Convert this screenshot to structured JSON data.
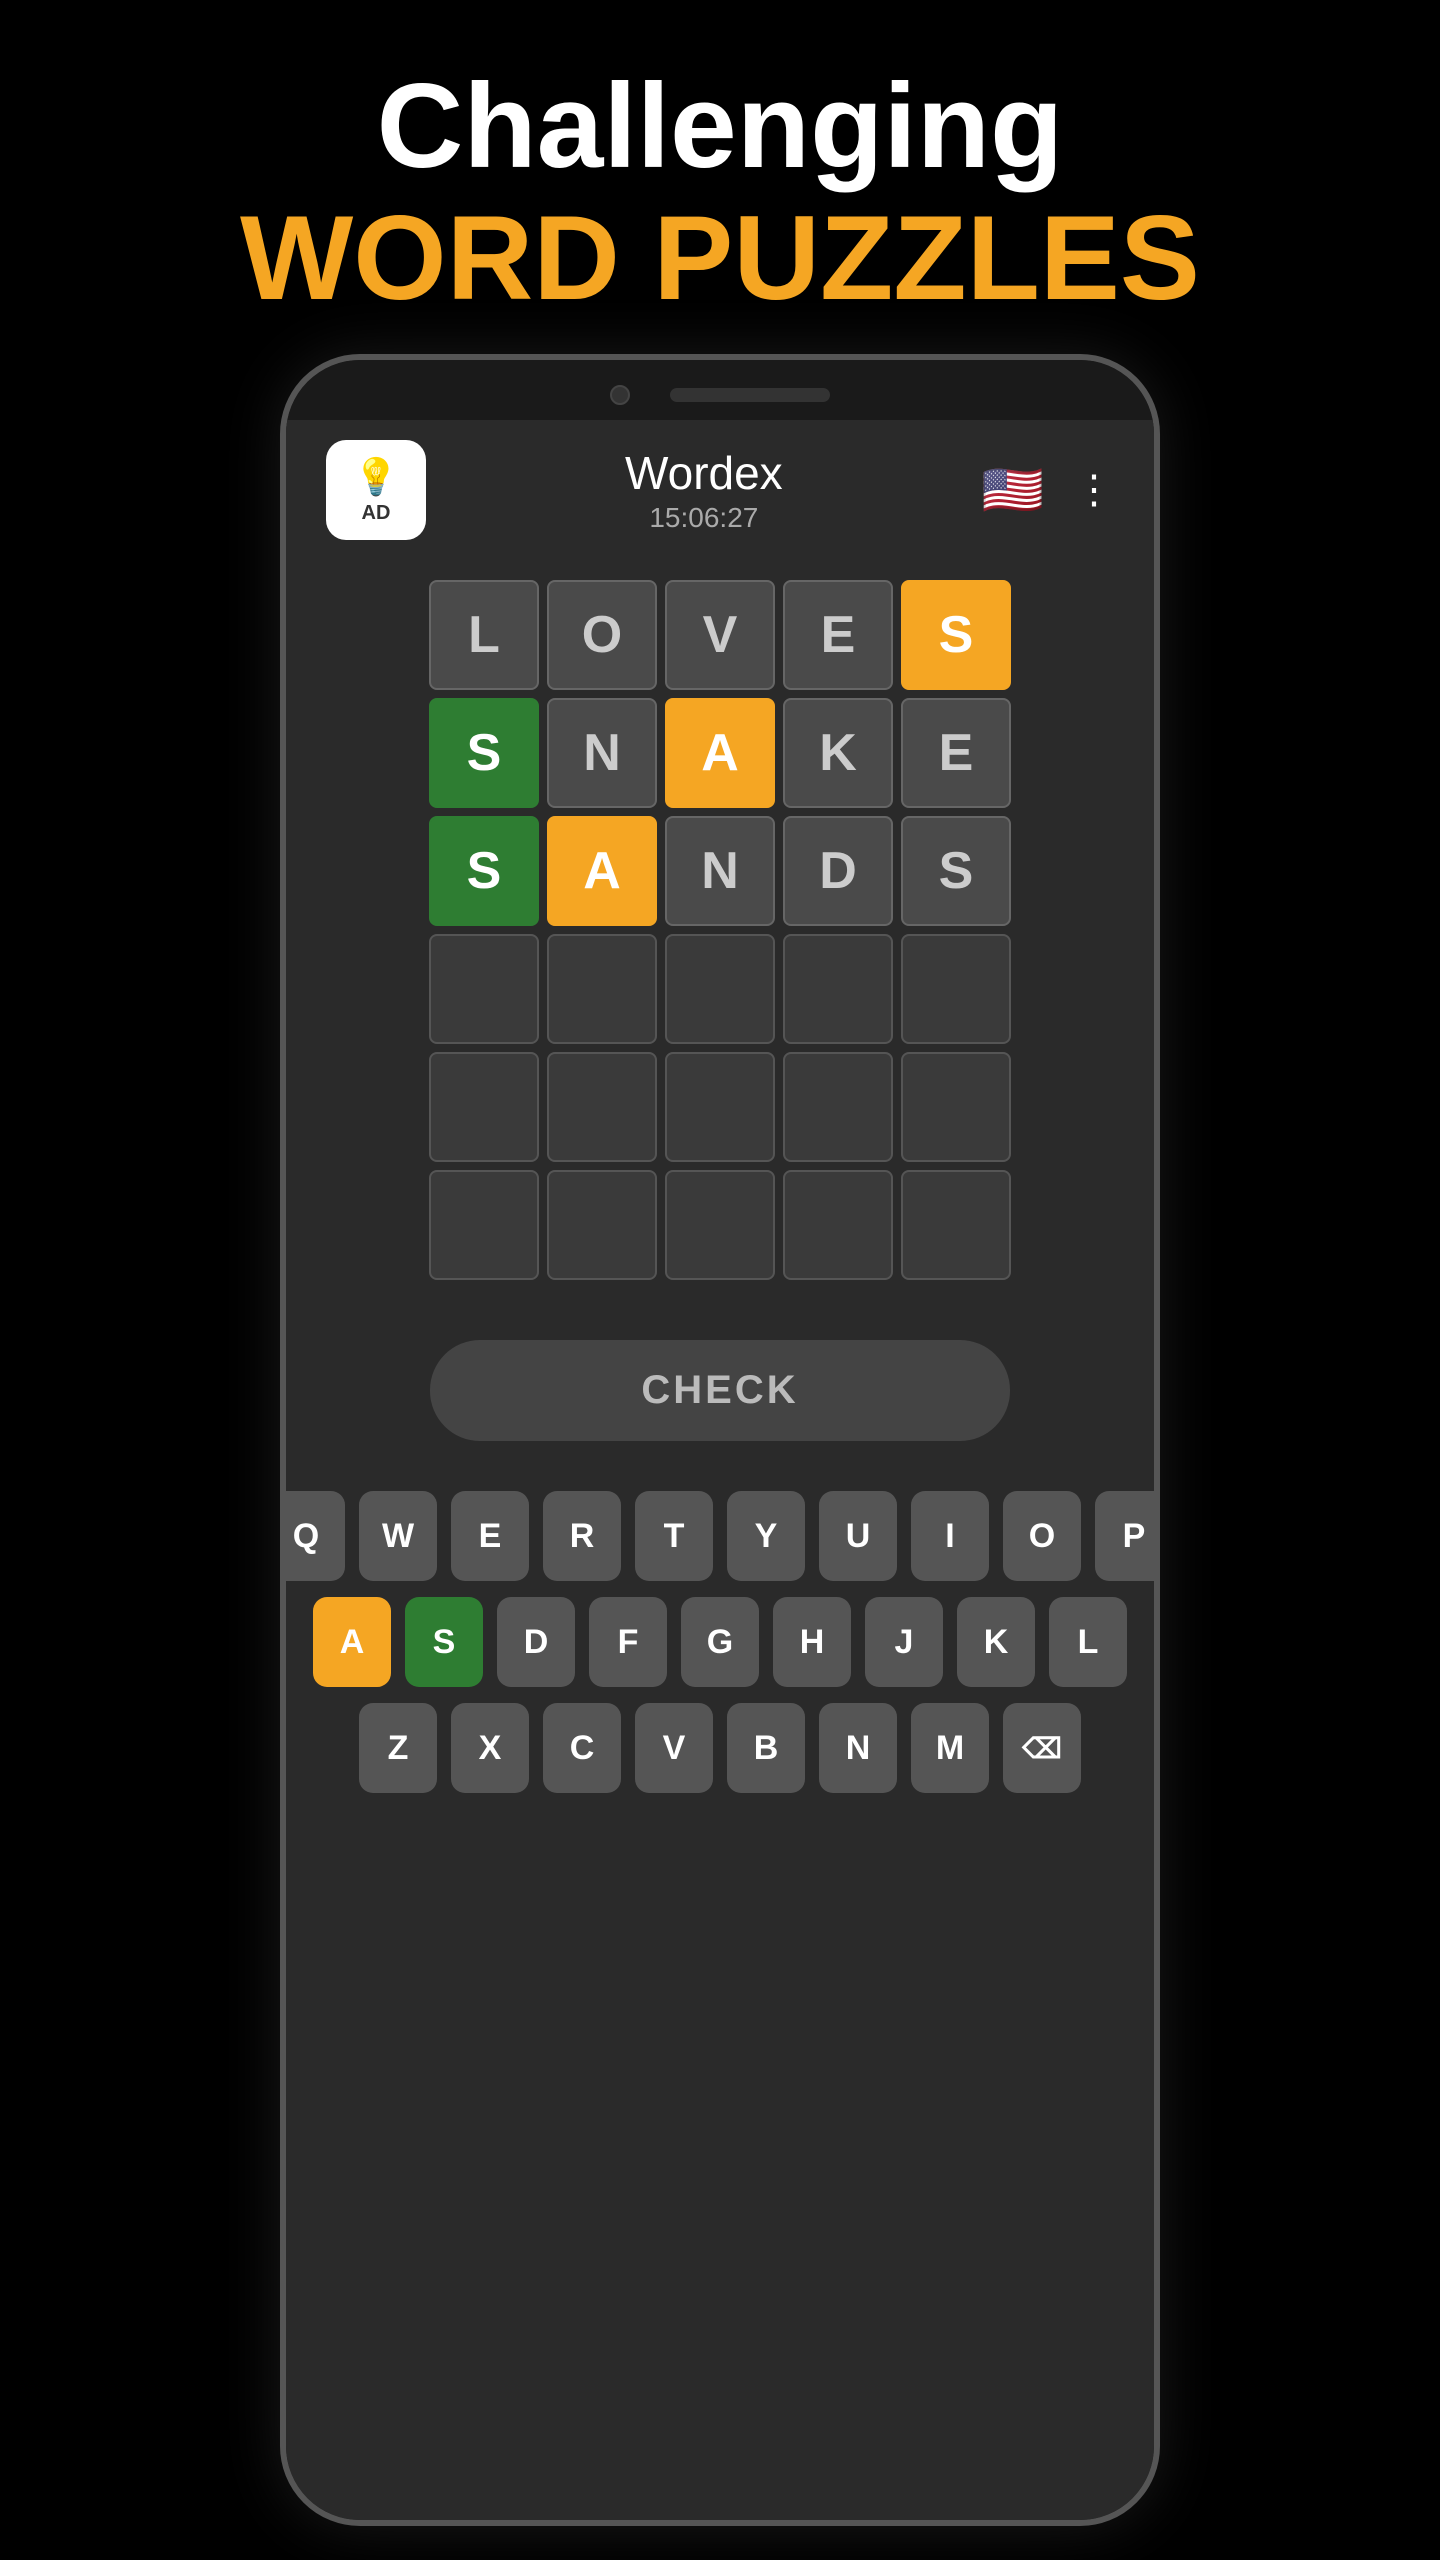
{
  "header": {
    "line1": "Challenging",
    "line2": "WORD PUZZLES"
  },
  "app": {
    "title": "Wordex",
    "timer": "15:06:27",
    "ad_label": "AD"
  },
  "grid": {
    "rows": [
      [
        {
          "letter": "L",
          "state": "letter"
        },
        {
          "letter": "O",
          "state": "letter"
        },
        {
          "letter": "V",
          "state": "letter"
        },
        {
          "letter": "E",
          "state": "letter"
        },
        {
          "letter": "S",
          "state": "yellow"
        }
      ],
      [
        {
          "letter": "S",
          "state": "green"
        },
        {
          "letter": "N",
          "state": "letter"
        },
        {
          "letter": "A",
          "state": "yellow"
        },
        {
          "letter": "K",
          "state": "letter"
        },
        {
          "letter": "E",
          "state": "letter"
        }
      ],
      [
        {
          "letter": "S",
          "state": "green"
        },
        {
          "letter": "A",
          "state": "yellow"
        },
        {
          "letter": "N",
          "state": "letter"
        },
        {
          "letter": "D",
          "state": "letter"
        },
        {
          "letter": "S",
          "state": "letter"
        }
      ],
      [
        {
          "letter": "",
          "state": "empty"
        },
        {
          "letter": "",
          "state": "empty"
        },
        {
          "letter": "",
          "state": "empty"
        },
        {
          "letter": "",
          "state": "empty"
        },
        {
          "letter": "",
          "state": "empty"
        }
      ],
      [
        {
          "letter": "",
          "state": "empty"
        },
        {
          "letter": "",
          "state": "empty"
        },
        {
          "letter": "",
          "state": "empty"
        },
        {
          "letter": "",
          "state": "empty"
        },
        {
          "letter": "",
          "state": "empty"
        }
      ],
      [
        {
          "letter": "",
          "state": "empty"
        },
        {
          "letter": "",
          "state": "empty"
        },
        {
          "letter": "",
          "state": "empty"
        },
        {
          "letter": "",
          "state": "empty"
        },
        {
          "letter": "",
          "state": "empty"
        }
      ]
    ]
  },
  "check_button": {
    "label": "CHECK"
  },
  "keyboard": {
    "rows": [
      [
        {
          "key": "Q",
          "state": "normal"
        },
        {
          "key": "W",
          "state": "normal"
        },
        {
          "key": "E",
          "state": "normal"
        },
        {
          "key": "R",
          "state": "normal"
        },
        {
          "key": "T",
          "state": "normal"
        },
        {
          "key": "Y",
          "state": "normal"
        },
        {
          "key": "U",
          "state": "normal"
        },
        {
          "key": "I",
          "state": "normal"
        },
        {
          "key": "O",
          "state": "normal"
        },
        {
          "key": "P",
          "state": "normal"
        }
      ],
      [
        {
          "key": "A",
          "state": "yellow"
        },
        {
          "key": "S",
          "state": "green"
        },
        {
          "key": "D",
          "state": "normal"
        },
        {
          "key": "F",
          "state": "normal"
        },
        {
          "key": "G",
          "state": "normal"
        },
        {
          "key": "H",
          "state": "normal"
        },
        {
          "key": "J",
          "state": "normal"
        },
        {
          "key": "K",
          "state": "normal"
        },
        {
          "key": "L",
          "state": "normal"
        }
      ],
      [
        {
          "key": "Z",
          "state": "normal"
        },
        {
          "key": "X",
          "state": "normal"
        },
        {
          "key": "C",
          "state": "normal"
        },
        {
          "key": "V",
          "state": "normal"
        },
        {
          "key": "B",
          "state": "normal"
        },
        {
          "key": "N",
          "state": "normal"
        },
        {
          "key": "M",
          "state": "normal"
        },
        {
          "key": "⌫",
          "state": "backspace"
        }
      ]
    ]
  }
}
